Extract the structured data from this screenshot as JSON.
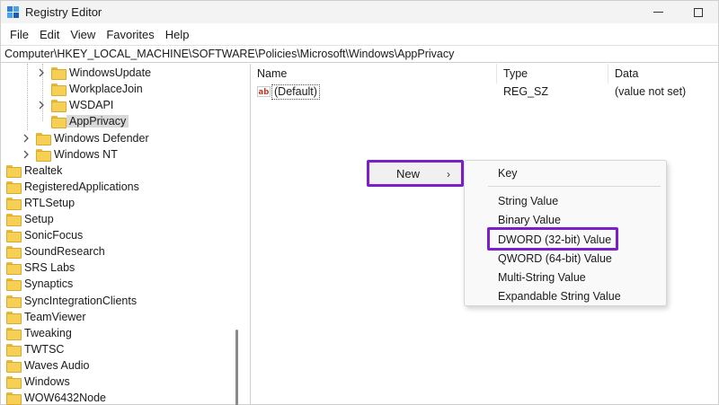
{
  "window": {
    "title": "Registry Editor"
  },
  "menubar": [
    "File",
    "Edit",
    "View",
    "Favorites",
    "Help"
  ],
  "address": "Computer\\HKEY_LOCAL_MACHINE\\SOFTWARE\\Policies\\Microsoft\\Windows\\AppPrivacy",
  "tree": {
    "items": [
      {
        "label": "WindowsUpdate",
        "expander": true
      },
      {
        "label": "WorkplaceJoin",
        "expander": false
      },
      {
        "label": "WSDAPI",
        "expander": true
      },
      {
        "label": "AppPrivacy",
        "expander": false,
        "selected": true
      },
      {
        "label": "Windows Defender",
        "expander": true
      },
      {
        "label": "Windows NT",
        "expander": true
      },
      {
        "label": "Realtek"
      },
      {
        "label": "RegisteredApplications"
      },
      {
        "label": "RTLSetup"
      },
      {
        "label": "Setup"
      },
      {
        "label": "SonicFocus"
      },
      {
        "label": "SoundResearch"
      },
      {
        "label": "SRS Labs"
      },
      {
        "label": "Synaptics"
      },
      {
        "label": "SyncIntegrationClients"
      },
      {
        "label": "TeamViewer"
      },
      {
        "label": "Tweaking"
      },
      {
        "label": "TWTSC"
      },
      {
        "label": "Waves Audio"
      },
      {
        "label": "Windows"
      },
      {
        "label": "WOW6432Node"
      }
    ]
  },
  "list": {
    "columns": {
      "name": "Name",
      "type": "Type",
      "data": "Data"
    },
    "rows": [
      {
        "name": "(Default)",
        "type": "REG_SZ",
        "data": "(value not set)"
      }
    ]
  },
  "context_menu": {
    "new_label": "New",
    "arrow": "›",
    "submenu": [
      "Key",
      "String Value",
      "Binary Value",
      "DWORD (32-bit) Value",
      "QWORD (64-bit) Value",
      "Multi-String Value",
      "Expandable String Value"
    ]
  },
  "colors": {
    "highlight": "#7b1fc9",
    "folder": "#f6cf55",
    "selection": "#d9d9d9"
  }
}
